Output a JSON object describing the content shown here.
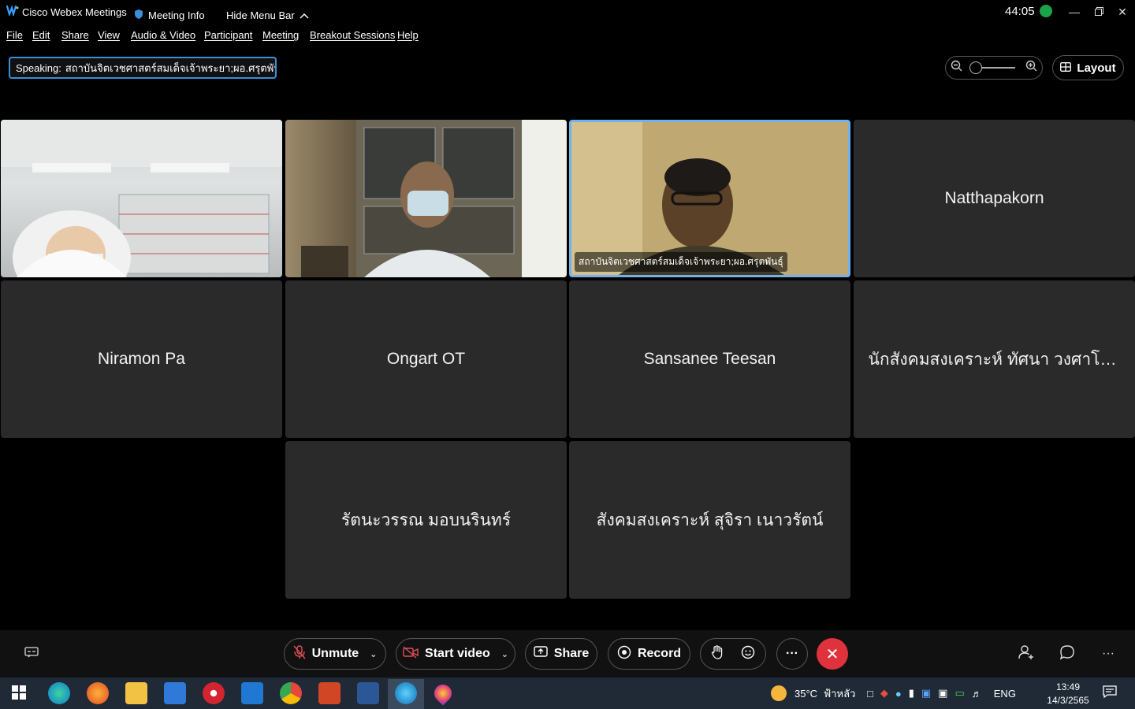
{
  "titlebar": {
    "app_title": "Cisco Webex Meetings",
    "meeting_info": "Meeting Info",
    "hide_menu": "Hide Menu Bar",
    "timer": "44:05"
  },
  "menu": [
    "File",
    "Edit",
    "Share",
    "View",
    "Audio & Video",
    "Participant",
    "Meeting",
    "Breakout Sessions",
    "Help"
  ],
  "speaking": {
    "label": "Speaking:",
    "name": "สถาบันจิตเวชศาสตร์สมเด็จเจ้าพระยา;ผอ.ศรุตพันธุ์"
  },
  "layout_button": "Layout",
  "tiles": [
    {
      "name": "",
      "video": true
    },
    {
      "name": "",
      "video": true
    },
    {
      "name": "สถาบันจิตเวชศาสตร์สมเด็จเจ้าพระยา;ผอ.ศรุตพันธุ์",
      "video": true,
      "active": true
    },
    {
      "name": "Natthapakorn"
    },
    {
      "name": "Niramon Pa"
    },
    {
      "name": "Ongart OT"
    },
    {
      "name": "Sansanee Teesan"
    },
    {
      "name": "นักสังคมสงเคราะห์ ทัศนา วงศาโรจ..."
    },
    {
      "name": "รัตนะวรรณ มอบนรินทร์"
    },
    {
      "name": "สังคมสงเคราะห์ สุจิรา เนาวรัตน์"
    }
  ],
  "controls": {
    "unmute": "Unmute",
    "start_video": "Start video",
    "share": "Share",
    "record": "Record"
  },
  "taskbar": {
    "weather": "35°C",
    "weather_desc": "ฟ้าหลัว",
    "lang": "ENG",
    "time": "13:49",
    "date": "14/3/2565"
  },
  "colors": {
    "end_button": "#e0323c",
    "active_border": "#6fb2ee",
    "tile_bg": "#2a2a2a"
  }
}
